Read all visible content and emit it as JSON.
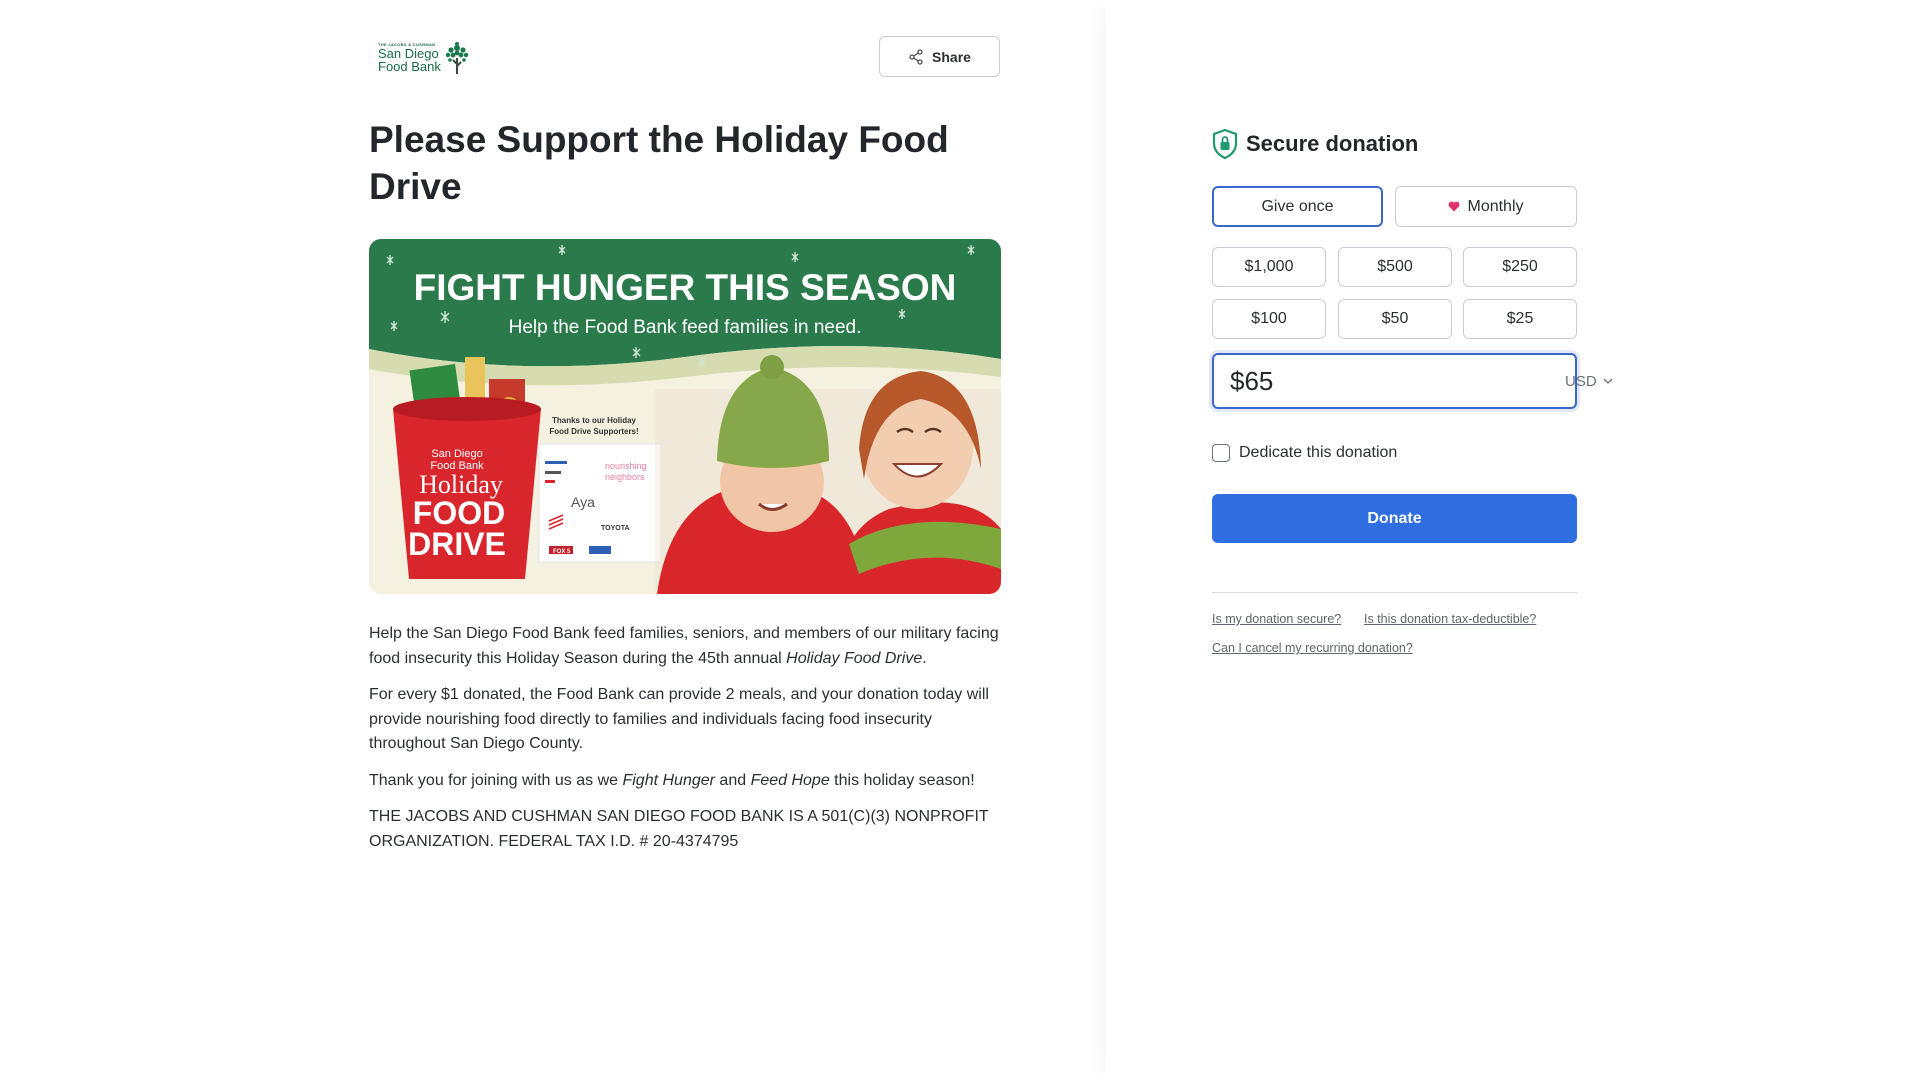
{
  "header": {
    "logo": {
      "small_text": "THE JACOBS & CUSHMAN",
      "line1": "San Diego",
      "line2": "Food Bank"
    },
    "share_label": "Share"
  },
  "page_title": "Please Support the Holiday Food Drive",
  "banner": {
    "headline": "FIGHT HUNGER THIS SEASON",
    "subhead": "Help the Food Bank feed families in need.",
    "bucket_logo_line1": "San Diego",
    "bucket_logo_line2": "Food Bank",
    "bucket_line1": "Holiday",
    "bucket_line2": "FOOD",
    "bucket_line3": "DRIVE",
    "sponsors_title_line1": "Thanks to our Holiday",
    "sponsors_title_line2": "Food Drive Supporters!",
    "sponsor_1": "nourishing",
    "sponsor_2": "neighbors",
    "sponsor_3": "Aya",
    "sponsor_4": "TOYOTA",
    "sponsor_5": "FOX 5",
    "colors": {
      "green": "#2a7a4b",
      "red": "#d9262c",
      "cream": "#f3f0dc"
    }
  },
  "description": {
    "p1_before": "Help the San Diego Food Bank feed families, seniors, and members of our military facing food insecurity this Holiday Season during the 45th annual ",
    "p1_em": "Holiday Food Drive",
    "p1_after": ".",
    "p2": "For every $1 donated, the Food Bank can provide 2 meals, and your donation today will provide nourishing food directly to families and individuals facing food insecurity throughout San Diego County.",
    "p3_before": "Thank you for joining with us as we ",
    "p3_em1": "Fight Hunger",
    "p3_mid": " and ",
    "p3_em2": "Feed Hope",
    "p3_after": " this holiday season!",
    "p4": "THE JACOBS AND CUSHMAN SAN DIEGO FOOD BANK IS A 501(C)(3) NONPROFIT ORGANIZATION. FEDERAL TAX I.D. # 20-4374795"
  },
  "donation": {
    "title": "Secure donation",
    "frequency": {
      "once": "Give once",
      "monthly": "Monthly",
      "selected": "once"
    },
    "amounts": [
      "$1,000",
      "$500",
      "$250",
      "$100",
      "$50",
      "$25"
    ],
    "amount_value": "$65",
    "currency": "USD",
    "dedicate_label": "Dedicate this donation",
    "donate_label": "Donate",
    "faq": {
      "q1": "Is my donation secure?",
      "q2": "Is this donation tax-deductible?",
      "q3": "Can I cancel my recurring donation?"
    },
    "colors": {
      "accent": "#2f6ee0",
      "shield": "#1f9a6e",
      "heart": "#e0336b"
    }
  }
}
